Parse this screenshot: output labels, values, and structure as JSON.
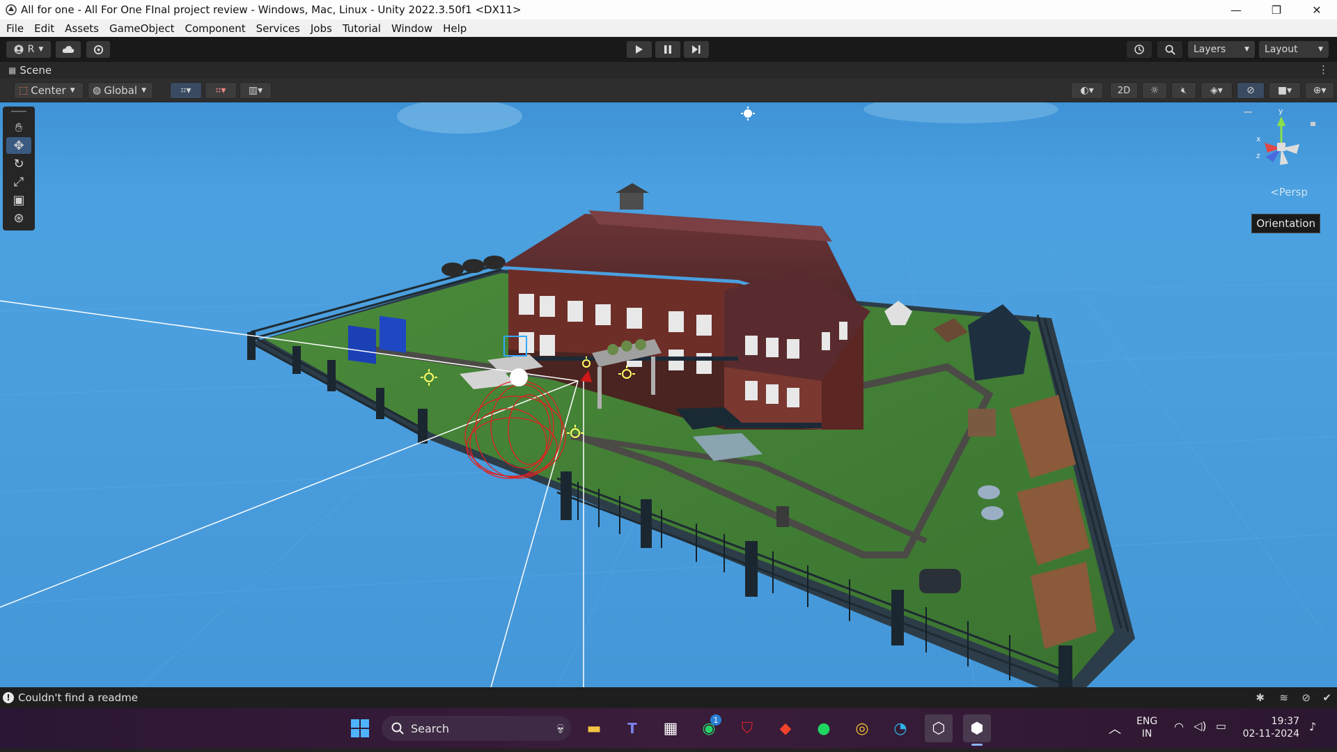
{
  "window": {
    "title": "All for one - All For One FInal project review - Windows, Mac, Linux - Unity 2022.3.50f1 <DX11>",
    "min_glyph": "—",
    "restore_glyph": "❐",
    "close_glyph": "✕"
  },
  "menu": [
    "File",
    "Edit",
    "Assets",
    "GameObject",
    "Component",
    "Services",
    "Jobs",
    "Tutorial",
    "Window",
    "Help"
  ],
  "toolbar": {
    "account_label": "R",
    "layers_label": "Layers",
    "layout_label": "Layout"
  },
  "scene": {
    "tab_label": "Scene",
    "pivot_label": "Center",
    "space_label": "Global",
    "mode_2d_label": "2D",
    "persp_label": "Persp",
    "orientation_tooltip": "Orientation",
    "axis_labels": {
      "y": "y",
      "x": "x",
      "z": "z"
    }
  },
  "status": {
    "message": "Couldn't find a readme"
  },
  "taskbar": {
    "search_label": "Search",
    "lang_line1": "ENG",
    "lang_line2": "IN",
    "time": "19:37",
    "date": "02-11-2024",
    "whatsapp_badge": "1"
  },
  "icons": {
    "accent": "#3a5a82",
    "sky": "#4aa0e0",
    "grass": "#3f7a35",
    "brick": "#6a2e2a"
  }
}
